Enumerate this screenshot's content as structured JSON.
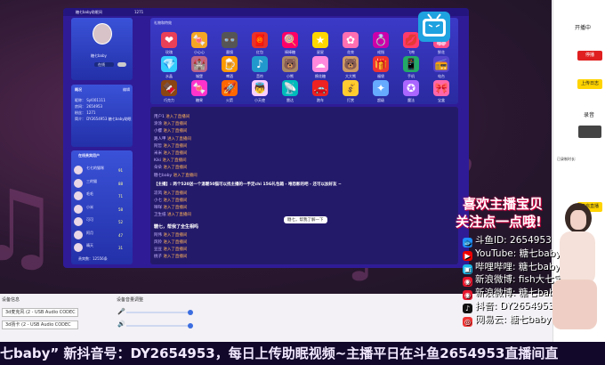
{
  "app": {
    "title": "糖七baby助眠间",
    "room_id": "1271"
  },
  "profile": {
    "name": "糖七baby",
    "status": "在线"
  },
  "info": {
    "title": "概况",
    "edit": "编辑",
    "lines": [
      "昵称：  Syl001111",
      "房间：  2654953",
      "粉丝：  1271",
      "简介：  DY2654953  糖七baby助眠"
    ]
  },
  "users": {
    "title": "在线贵宾用户",
    "count_label": "贵宾数：12556条",
    "items": [
      {
        "name": "七七的猫咪",
        "v": "91"
      },
      {
        "name": "三的猫",
        "v": "88"
      },
      {
        "name": "毛毛",
        "v": "71"
      },
      {
        "name": "小米",
        "v": "58"
      },
      {
        "name": "可可",
        "v": "52"
      },
      {
        "name": "阿月",
        "v": "47"
      },
      {
        "name": "晴天",
        "v": "31"
      }
    ]
  },
  "gifts": {
    "title": "礼物和特效",
    "items": [
      "玫瑰",
      "小心心",
      "墨镜",
      "红包",
      "棒棒糖",
      "星星",
      "花束",
      "戒指",
      "飞吻",
      "鲜花",
      "水晶",
      "城堡",
      "啤酒",
      "音符",
      "小熊",
      "棉花糖",
      "大大熊",
      "福袋",
      "手机",
      "电台",
      "巧克力",
      "糖果",
      "火箭",
      "小天使",
      "雷达",
      "跑车",
      "打赏",
      "超级",
      "魔法",
      "宝盒"
    ],
    "icons": [
      "❤",
      "🍬",
      "👓",
      "🧧",
      "🍭",
      "★",
      "✿",
      "💍",
      "💋",
      "🌸",
      "💎",
      "🏰",
      "🍺",
      "♪",
      "🐻",
      "☁",
      "🐻",
      "🎁",
      "📱",
      "📻",
      "🍫",
      "🍬",
      "🚀",
      "👼",
      "📡",
      "🚗",
      "💰",
      "✦",
      "✪",
      "🎀"
    ],
    "colors": [
      "#e94057",
      "#f5a623",
      "#555",
      "#e8322a",
      "#f06",
      "#ffd700",
      "#ff6fb1",
      "#c0a",
      "#ff3b6b",
      "#ff4f8b",
      "#3cf",
      "#b68",
      "#f90",
      "#29c",
      "#a86",
      "#f8d",
      "#c96",
      "#e33",
      "#2a6",
      "#54c",
      "#8b4513",
      "#f3c",
      "#f60",
      "#fcf",
      "#0bb",
      "#e22",
      "#fc3",
      "#6af",
      "#a6f",
      "#f6a"
    ]
  },
  "chat": {
    "messages": [
      {
        "n": "用户1",
        "t": "进入了直播间"
      },
      {
        "n": "涂涂",
        "t": "进入了直播间"
      },
      {
        "n": "小樱",
        "t": "进入了直播间"
      },
      {
        "n": "路人甲",
        "t": "进入了直播间"
      },
      {
        "n": "阿哲",
        "t": "进入了直播间"
      },
      {
        "n": "米米",
        "t": "进入了直播间"
      },
      {
        "n": "Kiki",
        "t": "进入了直播间"
      },
      {
        "n": "朵朵",
        "t": "进入了直播间"
      },
      {
        "n": "糖七baby",
        "t": "进入了直播间"
      }
    ],
    "notice": "【主播】: 两个520送一个温暖50猫可以找主播的一手定chi 15G礼包箱 - 唯恐影的吧 - 还可以加好友 ~",
    "messages2": [
      {
        "n": "凉风",
        "t": "进入了直播间"
      },
      {
        "n": "小七",
        "t": "进入了直播间"
      },
      {
        "n": "咩咩",
        "t": "进入了直播间"
      },
      {
        "n": "卫生纸",
        "t": "进入了直播间"
      }
    ],
    "bubble": "糖七，帮我了解一下",
    "highlight": "糖七，帮我了全生相吗",
    "messages3": [
      {
        "n": "阿伟",
        "t": "进入了直播间"
      },
      {
        "n": "风铃",
        "t": "进入了直播间"
      },
      {
        "n": "豆豆",
        "t": "进入了直播间"
      },
      {
        "n": "桃子",
        "t": "进入了直播间"
      }
    ]
  },
  "right": {
    "status": "开播中",
    "stop": "停播",
    "upload": "上传日志",
    "record": "录音",
    "duration": "已录制时长:",
    "paid": "开启直播",
    "edit": "编辑"
  },
  "controls": {
    "device_title": "设备信息",
    "volume_title": "设备音量调整",
    "mic": "3d麦克风 (2 - USB Audio CODEC",
    "spk": "3d扬卡 (2 - USB Audio CODEC"
  },
  "promo": {
    "t1": "喜欢主播宝贝",
    "t2": "关注点一点哦!",
    "lines": [
      "斗鱼ID:  2654953",
      "YouTube:  糖七baby",
      "哔哩哔哩: 糖七baby",
      "新浪微博: fish大七宝",
      "新浪微博: 糖七baby助眠",
      "抖音: DY2654953",
      "网易云: 糖七baby"
    ]
  },
  "ticker": {
    "text": "七baby” 新抖音号：DY2654953，每日上传助眠视频~主播平日在斗鱼2654953直播间直"
  }
}
